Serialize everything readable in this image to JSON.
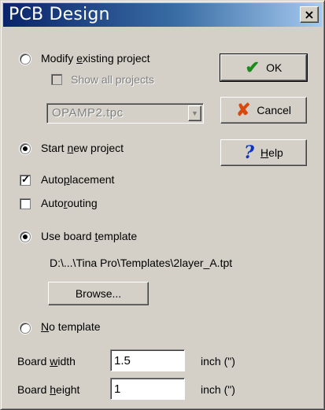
{
  "window": {
    "title": "PCB Design",
    "close_label": "×"
  },
  "modify_project": {
    "label_pre": "Modify ",
    "label_key": "e",
    "label_post": "xisting project",
    "checked": false,
    "show_all": {
      "label": "Show all projects",
      "checked": false,
      "disabled": true
    },
    "project_combo": {
      "value": "OPAMP2.tpc",
      "disabled": true
    }
  },
  "start_new": {
    "label_pre": "Start ",
    "label_key": "n",
    "label_post": "ew project",
    "checked": true
  },
  "autoplacement": {
    "label_pre": "Auto",
    "label_key": "p",
    "label_post": "lacement",
    "checked": true
  },
  "autorouting": {
    "label_pre": "Auto",
    "label_key": "r",
    "label_post": "outing",
    "checked": false
  },
  "use_template": {
    "label_pre": "Use board ",
    "label_key": "t",
    "label_post": "emplate",
    "checked": true,
    "path": "D:\\...\\Tina Pro\\Templates\\2layer_A.tpt",
    "browse_label": "Browse..."
  },
  "no_template": {
    "label_key": "N",
    "label_post": "o template",
    "checked": false
  },
  "board_width": {
    "label_pre": "Board ",
    "label_key": "w",
    "label_post": "idth",
    "value": "1.5",
    "unit": "inch (\")"
  },
  "board_height": {
    "label_pre": "Board ",
    "label_key": "h",
    "label_post": "eight",
    "value": "1",
    "unit": "inch (\")"
  },
  "buttons": {
    "ok": {
      "label": "OK",
      "icon": "check-icon"
    },
    "cancel": {
      "label": "Cancel",
      "icon": "x-icon"
    },
    "help": {
      "label_key": "H",
      "label_post": "elp",
      "icon": "question-icon"
    }
  },
  "colors": {
    "title_start": "#0a246a",
    "title_end": "#a6caf0",
    "face": "#d4d0c8",
    "ok_icon": "#1c8a1c",
    "cancel_icon": "#d9480f",
    "help_icon": "#0b34c7"
  }
}
